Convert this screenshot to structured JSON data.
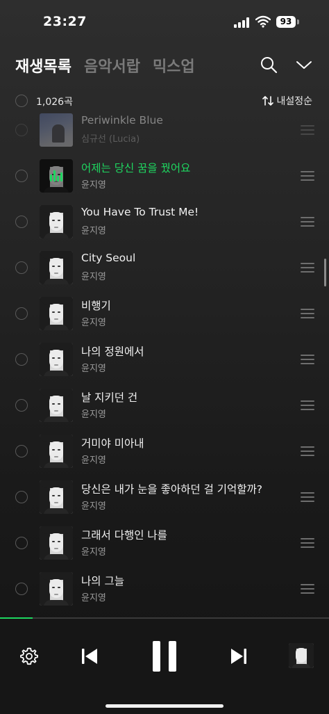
{
  "status_bar": {
    "time": "23:27",
    "battery": "93"
  },
  "tabs": [
    {
      "label": "재생목록",
      "active": true
    },
    {
      "label": "음악서랍",
      "active": false
    },
    {
      "label": "믹스업",
      "active": false
    }
  ],
  "list_header": {
    "count": "1,026곡",
    "sort_label": "내설정순",
    "sort_icon": "sort-arrows-icon"
  },
  "tracks": [
    {
      "title": "Periwinkle Blue",
      "artist": "심규선 (Lucia)",
      "art": "blue-album",
      "faded": true
    },
    {
      "title": "어제는 당신 꿈을 꿨어요",
      "artist": "윤지영",
      "art": "portrait",
      "playing": true
    },
    {
      "title": "You Have To Trust Me!",
      "artist": "윤지영",
      "art": "portrait"
    },
    {
      "title": "City Seoul",
      "artist": "윤지영",
      "art": "portrait"
    },
    {
      "title": "비행기",
      "artist": "윤지영",
      "art": "portrait"
    },
    {
      "title": "나의 정원에서",
      "artist": "윤지영",
      "art": "portrait"
    },
    {
      "title": "날 지키던 건",
      "artist": "윤지영",
      "art": "portrait"
    },
    {
      "title": "거미야 미아내",
      "artist": "윤지영",
      "art": "portrait"
    },
    {
      "title": "당신은 내가 눈을 좋아하던 걸 기억할까?",
      "artist": "윤지영",
      "art": "portrait"
    },
    {
      "title": "그래서 다행인 나를",
      "artist": "윤지영",
      "art": "portrait"
    },
    {
      "title": "나의 그늘",
      "artist": "윤지영",
      "art": "portrait"
    }
  ],
  "player": {
    "progress": 0.1,
    "state": "playing"
  },
  "colors": {
    "accent": "#1ed760",
    "background": "#1a1a1a",
    "muted_text": "#9b9b9b"
  }
}
